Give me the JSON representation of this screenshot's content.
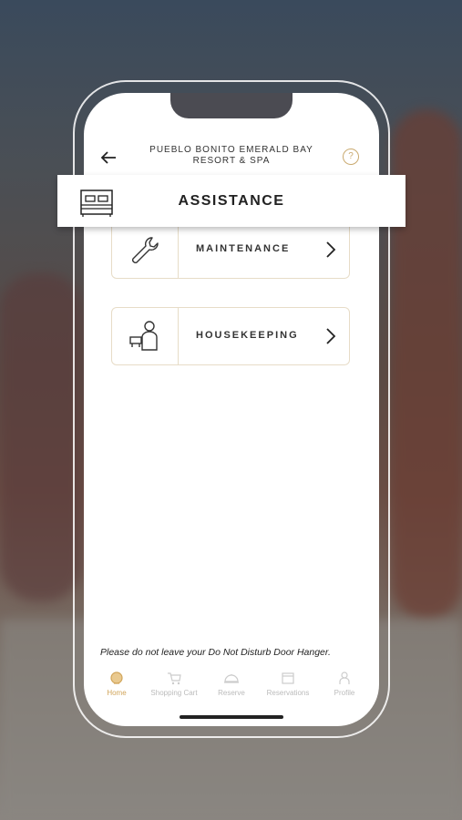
{
  "header": {
    "title_line1": "PUEBLO BONITO EMERALD BAY",
    "title_line2": "RESORT & SPA",
    "back_icon": "back-arrow-icon",
    "help_icon": "help-icon",
    "help_glyph": "?"
  },
  "banner": {
    "title": "ASSISTANCE",
    "icon": "bed-icon"
  },
  "services": [
    {
      "label": "MAINTENANCE",
      "icon": "wrench-icon"
    },
    {
      "label": "HOUSEKEEPING",
      "icon": "housekeeping-icon"
    }
  ],
  "notice": "Please do not leave your Do Not Disturb Door Hanger.",
  "tabs": [
    {
      "label": "Home",
      "icon": "home-icon",
      "active": true
    },
    {
      "label": "Shopping Cart",
      "icon": "cart-icon"
    },
    {
      "label": "Reserve",
      "icon": "reserve-icon"
    },
    {
      "label": "Reservations",
      "icon": "calendar-icon"
    },
    {
      "label": "Profile",
      "icon": "profile-icon"
    }
  ],
  "colors": {
    "accent": "#d1a55a",
    "card_border": "#e7dcc7"
  }
}
